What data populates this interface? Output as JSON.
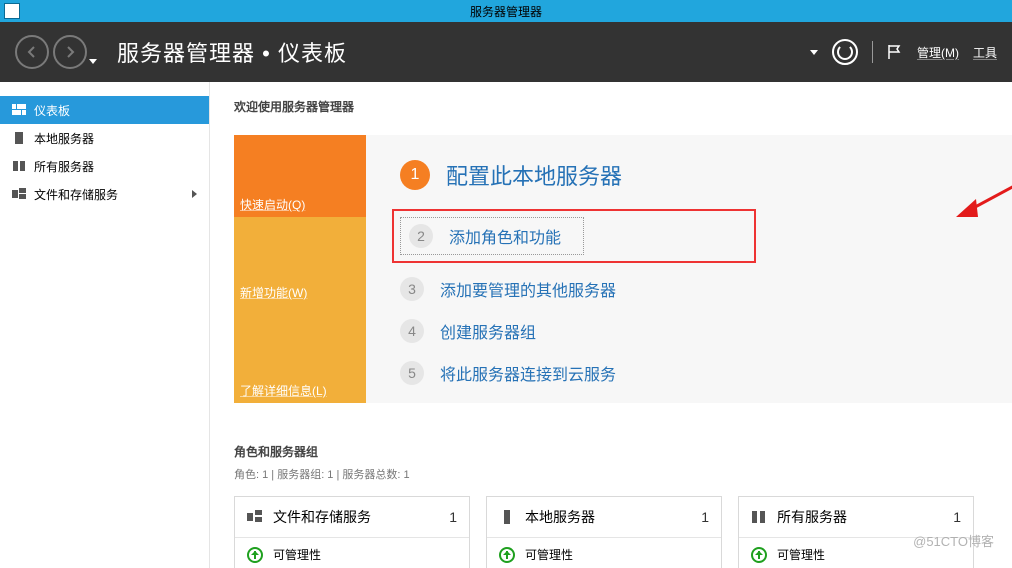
{
  "titlebar": {
    "title": "服务器管理器"
  },
  "header": {
    "breadcrumb_app": "服务器管理器",
    "breadcrumb_page": "仪表板",
    "menu_manage": "管理(M)",
    "menu_tools": "工具"
  },
  "sidebar": {
    "items": [
      {
        "label": "仪表板"
      },
      {
        "label": "本地服务器"
      },
      {
        "label": "所有服务器"
      },
      {
        "label": "文件和存储服务"
      }
    ]
  },
  "welcome": {
    "title": "欢迎使用服务器管理器",
    "tiles": {
      "quickstart": "快速启动(Q)",
      "whatsnew": "新增功能(W)",
      "learnmore": "了解详细信息(L)"
    },
    "steps": [
      {
        "n": "1",
        "text": "配置此本地服务器"
      },
      {
        "n": "2",
        "text": "添加角色和功能"
      },
      {
        "n": "3",
        "text": "添加要管理的其他服务器"
      },
      {
        "n": "4",
        "text": "创建服务器组"
      },
      {
        "n": "5",
        "text": "将此服务器连接到云服务"
      }
    ]
  },
  "roles": {
    "title": "角色和服务器组",
    "subtitle": "角色: 1 | 服务器组: 1 | 服务器总数: 1",
    "cards": [
      {
        "title": "文件和存储服务",
        "count": "1",
        "row1": "可管理性"
      },
      {
        "title": "本地服务器",
        "count": "1",
        "row1": "可管理性"
      },
      {
        "title": "所有服务器",
        "count": "1",
        "row1": "可管理性"
      }
    ]
  },
  "watermark": "@51CTO博客"
}
